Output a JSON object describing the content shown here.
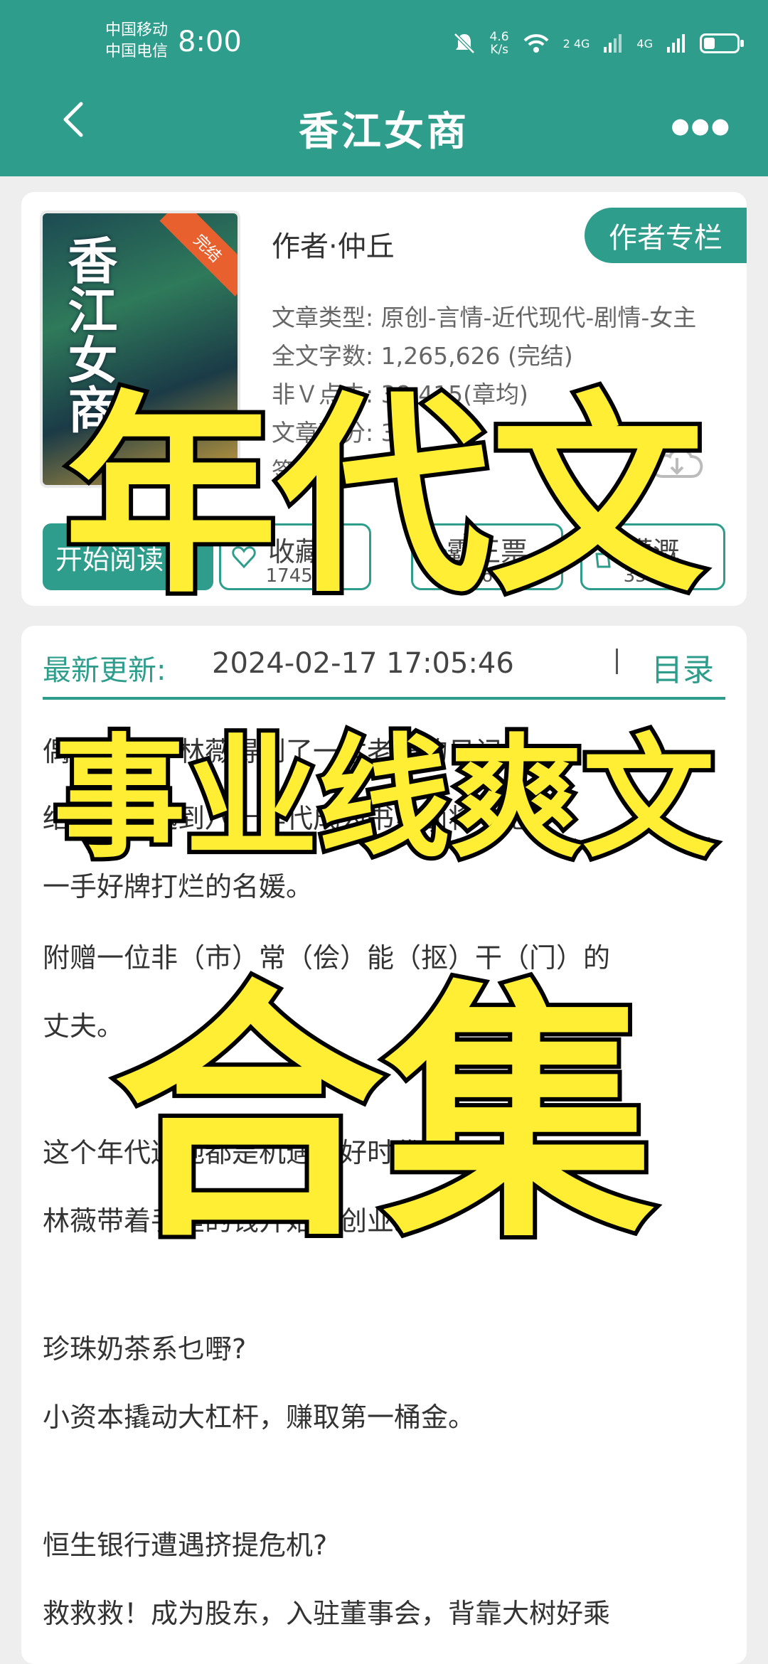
{
  "status_bar": {
    "carrier1": "中国移动",
    "carrier2": "中国电信",
    "time": "8:00",
    "net_speed_value": "4.6",
    "net_speed_unit": "K/s",
    "signal1": "2 4G",
    "signal2": "4G",
    "battery_level": 0.35
  },
  "nav": {
    "title": "香江女商"
  },
  "book": {
    "cover_title": "香江女商",
    "cover_badge": "完结",
    "author": "作者·仲丘",
    "author_column_label": "作者专栏",
    "info_lines": [
      "文章类型: 原创-言情-近代现代-剧情-女主",
      "全文字数: 1,265,626 (完结)",
      "非Ｖ点击: 38,415(章均)",
      "文章积分: 3,2",
      "签约状态:"
    ],
    "start_label": "开始阅读",
    "stats": [
      {
        "label": "收藏",
        "count": "17458"
      },
      {
        "label": "霸王票",
        "count": "33684"
      },
      {
        "label": "灌溉",
        "count": "35978"
      }
    ]
  },
  "update": {
    "label": "最新更新:",
    "time": "2024-02-17 17:05:46",
    "toc_label": "目录"
  },
  "synopsis": [
    "偶然之间，林薇得到了一本老旧的日记。",
    "结果她穿越到八十年代成为书里面将一把",
    "一手好牌打烂的名媛。",
    "附赠一位非（市）常（侩）能（抠）干（门）的",
    "丈夫。",
    "这个年代遍地都是机遇的好时代，",
    "林薇带着手里的钱开始了创业。",
    "珍珠奶茶系乜嘢?",
    "小资本撬动大杠杆，赚取第一桶金。",
    "恒生银行遭遇挤提危机?",
    "救救救！成为股东，入驻董事会，背靠大树好乘"
  ],
  "overlay": {
    "line1": "年代文",
    "line2": "事业线爽文",
    "line3": "合集"
  },
  "colors": {
    "accent": "#2e9d8c",
    "overlay_fill": "#ffee33",
    "overlay_stroke": "#000000"
  }
}
